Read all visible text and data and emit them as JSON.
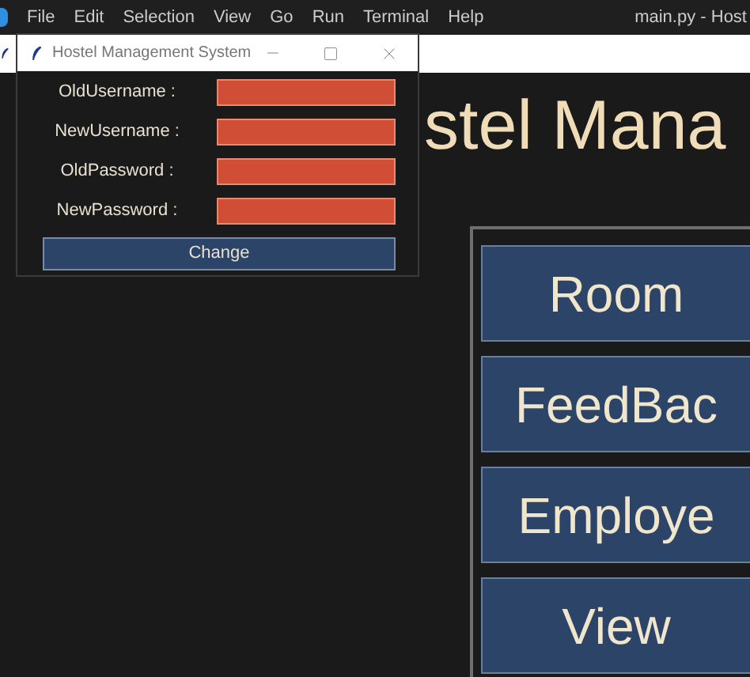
{
  "editor": {
    "menu": [
      "File",
      "Edit",
      "Selection",
      "View",
      "Go",
      "Run",
      "Terminal",
      "Help"
    ],
    "title": "main.py - Host"
  },
  "app_window": {
    "heading": "stel Mana",
    "menu_buttons": [
      {
        "label": "Room"
      },
      {
        "label": "FeedBac"
      },
      {
        "label": "Employe"
      },
      {
        "label": "View"
      }
    ]
  },
  "dialog": {
    "title": "Hostel Management System",
    "fields": [
      {
        "label": "OldUsername :"
      },
      {
        "label": "NewUsername :"
      },
      {
        "label": "OldPassword :"
      },
      {
        "label": "NewPassword :"
      }
    ],
    "button": "Change"
  }
}
